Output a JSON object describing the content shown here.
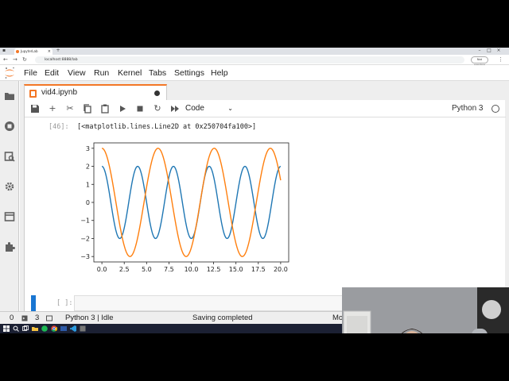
{
  "browser": {
    "tab_title": "JupyterLab",
    "url": "localhost:8888/lab",
    "profile_label": "Not syncing"
  },
  "menubar": {
    "items": [
      "File",
      "Edit",
      "View",
      "Run",
      "Kernel",
      "Tabs",
      "Settings",
      "Help"
    ]
  },
  "notebook": {
    "tab_title": "vid4.ipynb",
    "toolbar": {
      "cell_type": "Code",
      "kernel_name": "Python 3"
    },
    "output_prompt": "[46]:",
    "output_text": "[<matplotlib.lines.Line2D at 0x250704fa100>]",
    "input_prompt": "[ ]:"
  },
  "chart_data": {
    "type": "line",
    "title": "",
    "xlabel": "",
    "ylabel": "",
    "xlim": [
      -0.9,
      20.9
    ],
    "ylim": [
      -3.3,
      3.3
    ],
    "xticks": [
      0.0,
      2.5,
      5.0,
      7.5,
      10.0,
      12.5,
      15.0,
      17.5,
      20.0
    ],
    "xtick_labels": [
      "0.0",
      "2.5",
      "5.0",
      "7.5",
      "10.0",
      "12.5",
      "15.0",
      "17.5",
      "20.0"
    ],
    "yticks": [
      -3,
      -2,
      -1,
      0,
      1,
      2,
      3
    ],
    "ytick_labels": [
      "−3",
      "−2",
      "−1",
      "0",
      "1",
      "2",
      "3"
    ],
    "grid": false,
    "series": [
      {
        "color": "#1f77b4",
        "amplitude": 2,
        "angular_freq": 1.57,
        "phase": 1.5708,
        "x_range": [
          0,
          20
        ]
      },
      {
        "color": "#ff7f0e",
        "amplitude": 3,
        "angular_freq": 1.0,
        "phase": 1.5708,
        "x_range": [
          0,
          20
        ]
      }
    ]
  },
  "statusbar": {
    "mode_count": "0",
    "terminal_count": "3",
    "kernel_status": "Python 3 | Idle",
    "save_status": "Saving completed",
    "mode": "Mo"
  },
  "colors": {
    "accent": "#f37726",
    "active_cell": "#1976d2",
    "series_1": "#1f77b4",
    "series_2": "#ff7f0e"
  }
}
